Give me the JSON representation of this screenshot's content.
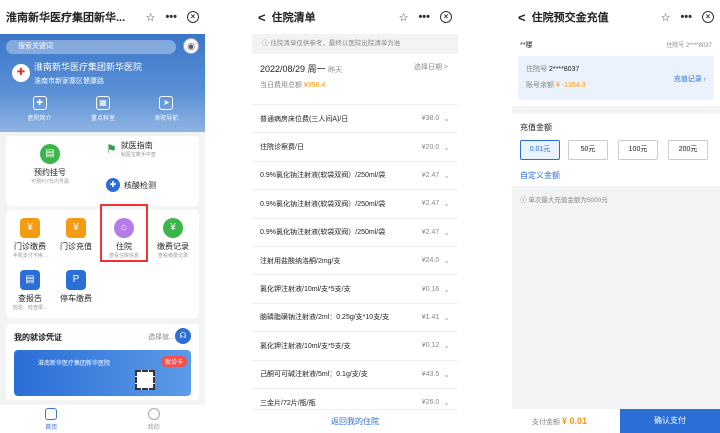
{
  "p1": {
    "title": "淮南新华医疗集团新华...",
    "search_placeholder": "搜索关键词",
    "hospital_name": "淮南新华医疗集团新华医院",
    "hospital_sub": "淮南市新家寨区健康路",
    "quick": [
      "医院简介",
      "重点科室",
      "来院导航"
    ],
    "tiles": {
      "guide": "就医指南",
      "guide_sub": "就医宝典手中查",
      "appt": "预约挂号",
      "appt_sub": "可预约7日内号源",
      "nat": "核酸检测",
      "op_pay": "门诊缴费",
      "op_pay_sub": "手机支付不排...",
      "op_charge": "门诊充值",
      "inpatient": "住院",
      "inpatient_sub": "查看住院信息",
      "pay_rec": "缴费记录",
      "pay_rec_sub": "查看缴费记录",
      "report": "查报告",
      "report_sub": "检验、检查报...",
      "parking": "停车缴费"
    },
    "voucher_title": "我的就诊凭证",
    "voucher_select": "选择就...",
    "card_hospital": "淮南新华医疗集团新华医院",
    "card_tag": "就诊卡",
    "tabs": [
      "首页",
      "我的"
    ]
  },
  "p2": {
    "title": "住院清单",
    "notice": "住院清单仅供参考，最终以医院出院清单为准",
    "date": "2022/08/29 周一",
    "date_rel": "昨天",
    "select_date": "选择日期 >",
    "total_label": "当日费用总额",
    "total_value": "¥396.4",
    "items": [
      {
        "name": "普通病房床位费(三人间A)/日",
        "price": "¥38.0"
      },
      {
        "name": "住院诊察费/日",
        "price": "¥20.0"
      },
      {
        "name": "0.9%氯化钠注射液(软袋双阀）/250ml/袋",
        "price": "¥2.47"
      },
      {
        "name": "0.9%氯化钠注射液(软袋双阀）/250ml/袋",
        "price": "¥2.47"
      },
      {
        "name": "0.9%氯化钠注射液(软袋双阀）/250ml/袋",
        "price": "¥2.47"
      },
      {
        "name": "注射用盐酸纳洛酮/2mg/支",
        "price": "¥24.0"
      },
      {
        "name": "氯化钾注射液/10ml/支*5支/支",
        "price": "¥0.16"
      },
      {
        "name": "脑磷脂磺钠注射液/2ml：0.25g/支*10支/支",
        "price": "¥1.41"
      },
      {
        "name": "氯化钾注射液/10ml/支*5支/支",
        "price": "¥0.12"
      },
      {
        "name": "己酮可可碱注射液/5ml：0.1g/支/支",
        "price": "¥43.5"
      },
      {
        "name": "三金片/72片/瓶/瓶",
        "price": "¥26.0"
      }
    ],
    "footer": "返回我的住院"
  },
  "p3": {
    "title": "住院预交金充值",
    "patient": "**楼",
    "hosp_no_label": "住院号 2****8037",
    "hosp_no": "住院号",
    "hosp_no_val": "2****8037",
    "balance_label": "账号余额",
    "balance": "¥ -1354.3",
    "recharge_record": "充值记录",
    "amount_title": "充值金额",
    "amounts": [
      "0.01元",
      "50元",
      "100元",
      "200元"
    ],
    "custom": "自定义金额",
    "hint": "单次最大充值金额为5000元",
    "pay_label": "支付金额",
    "pay_value": "¥ 0.01",
    "pay_button": "确认支付"
  }
}
